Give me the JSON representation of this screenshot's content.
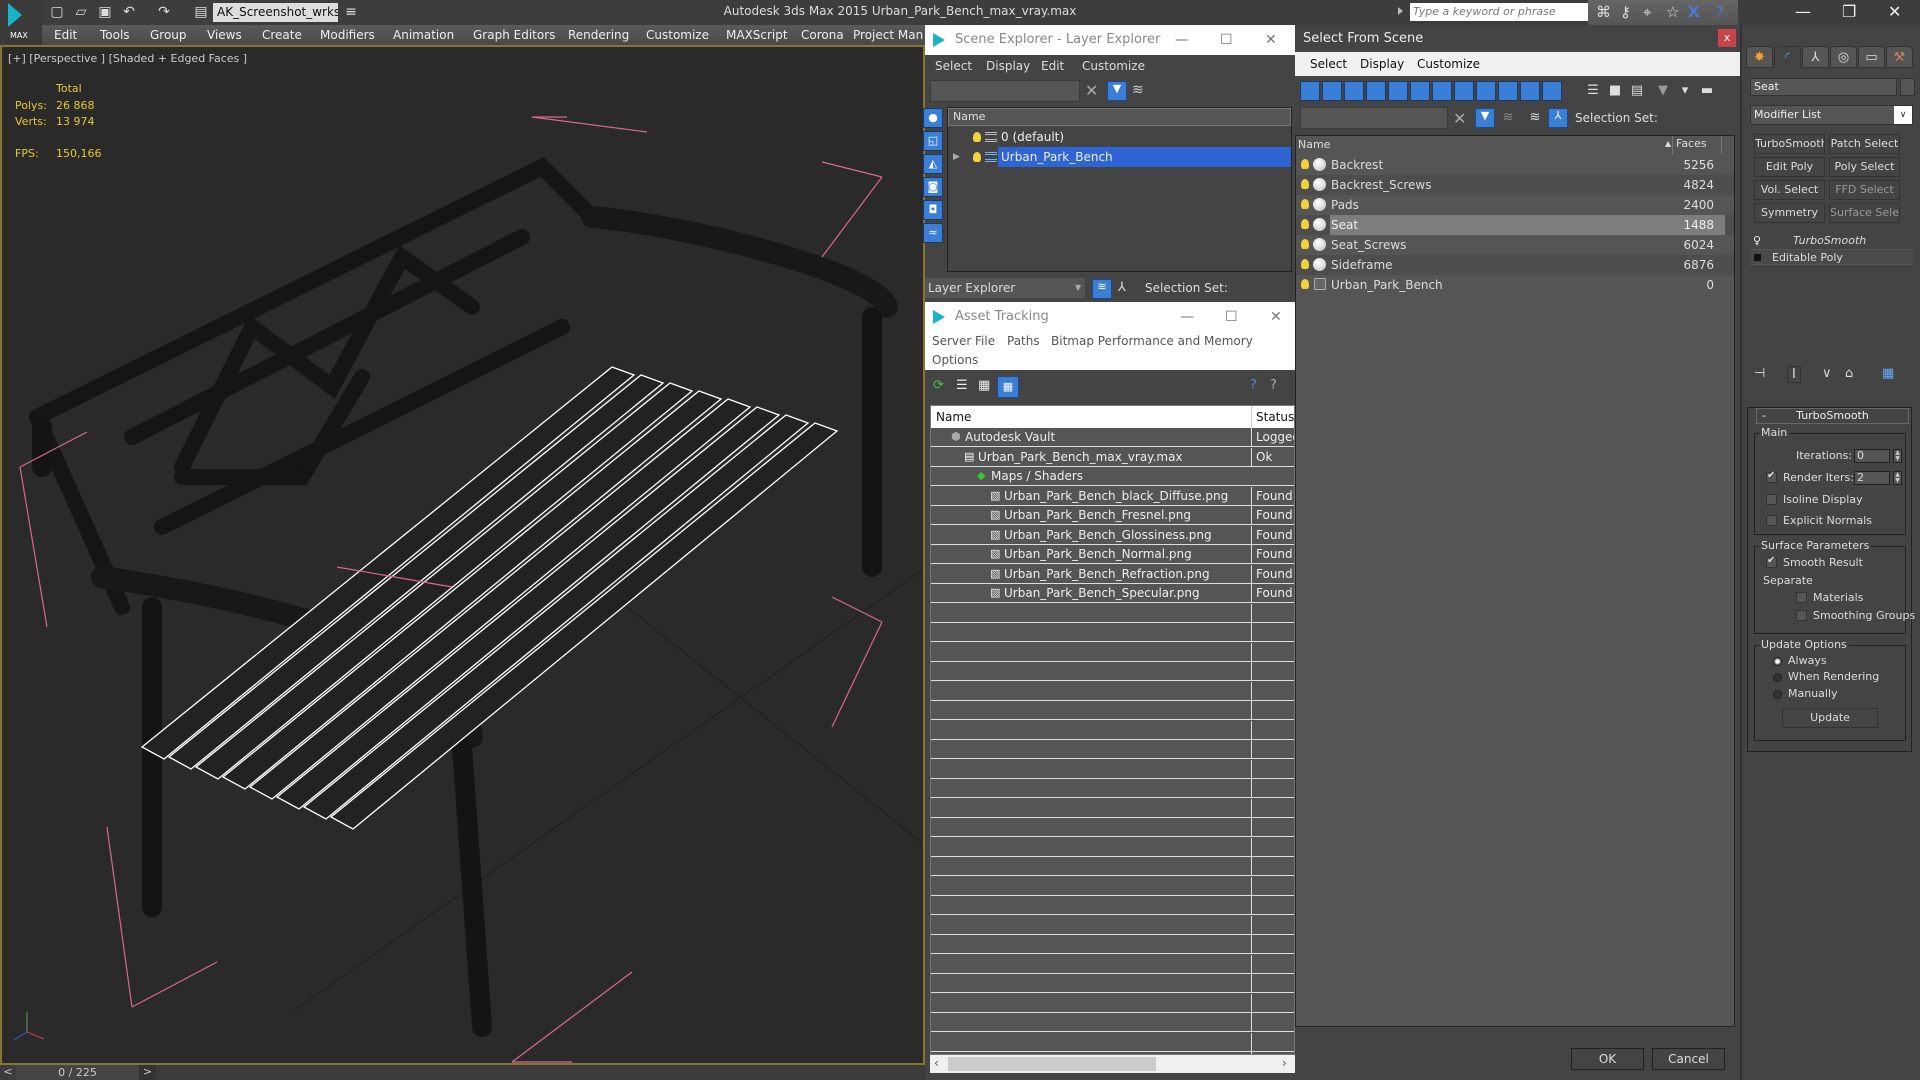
{
  "app": {
    "title": "Autodesk 3ds Max  2015    Urban_Park_Bench_max_vray.max",
    "logo_label": "MAX",
    "workspace": "AK_Screenshot_wrksp",
    "search_placeholder": "Type a keyword or phrase"
  },
  "menu": [
    "Edit",
    "Tools",
    "Group",
    "Views",
    "Create",
    "Modifiers",
    "Animation",
    "Graph Editors",
    "Rendering",
    "Customize",
    "MAXScript",
    "Corona",
    "Project Man"
  ],
  "viewport": {
    "label": "[+] [Perspective ] [Shaded + Edged Faces ]",
    "stats": {
      "total_label": "Total",
      "polys_label": "Polys:",
      "polys": "26 868",
      "verts_label": "Verts:",
      "verts": "13 974",
      "fps_label": "FPS:",
      "fps": "150,166"
    },
    "highlight_color": "#8a7434"
  },
  "timeline": {
    "prev": "<",
    "frame": "0 / 225",
    "next": ">"
  },
  "scene_explorer": {
    "title": "Scene Explorer - Layer Explorer",
    "menu": [
      "Select",
      "Display",
      "Edit",
      "Customize"
    ],
    "column": "Name",
    "rows": [
      {
        "name": "0 (default)",
        "selected": false
      },
      {
        "name": "Urban_Park_Bench",
        "selected": true
      }
    ],
    "mode": "Layer Explorer",
    "selection_set_label": "Selection Set:"
  },
  "asset_tracking": {
    "title": "Asset Tracking",
    "menu": [
      "Server",
      "File",
      "Paths",
      "Bitmap Performance and Memory",
      "Options"
    ],
    "columns": [
      "Name",
      "Status"
    ],
    "rows": [
      {
        "name": "Autodesk Vault",
        "status": "Logged",
        "level": 0,
        "icon": "vault-icon"
      },
      {
        "name": "Urban_Park_Bench_max_vray.max",
        "status": "Ok",
        "level": 1,
        "icon": "max-file-icon"
      },
      {
        "name": "Maps / Shaders",
        "status": "",
        "level": 2,
        "icon": "maps-icon"
      },
      {
        "name": "Urban_Park_Bench_black_Diffuse.png",
        "status": "Found",
        "level": 3,
        "icon": "image-file-icon"
      },
      {
        "name": "Urban_Park_Bench_Fresnel.png",
        "status": "Found",
        "level": 3,
        "icon": "image-file-icon"
      },
      {
        "name": "Urban_Park_Bench_Glossiness.png",
        "status": "Found",
        "level": 3,
        "icon": "image-file-icon"
      },
      {
        "name": "Urban_Park_Bench_Normal.png",
        "status": "Found",
        "level": 3,
        "icon": "image-file-icon"
      },
      {
        "name": "Urban_Park_Bench_Refraction.png",
        "status": "Found",
        "level": 3,
        "icon": "image-file-icon"
      },
      {
        "name": "Urban_Park_Bench_Specular.png",
        "status": "Found",
        "level": 3,
        "icon": "image-file-icon"
      }
    ]
  },
  "select_from_scene": {
    "title": "Select From Scene",
    "close": "x",
    "menu": [
      "Select",
      "Display",
      "Customize"
    ],
    "selection_set_label": "Selection Set:",
    "columns": [
      "Name",
      "Faces"
    ],
    "objects": [
      {
        "name": "Backrest",
        "faces": "5256",
        "selected": false,
        "icon": "geometry"
      },
      {
        "name": "Backrest_Screws",
        "faces": "4824",
        "selected": false,
        "icon": "geometry"
      },
      {
        "name": "Pads",
        "faces": "2400",
        "selected": false,
        "icon": "geometry"
      },
      {
        "name": "Seat",
        "faces": "1488",
        "selected": true,
        "icon": "geometry"
      },
      {
        "name": "Seat_Screws",
        "faces": "6024",
        "selected": false,
        "icon": "geometry"
      },
      {
        "name": "Sideframe",
        "faces": "6876",
        "selected": false,
        "icon": "geometry"
      },
      {
        "name": "Urban_Park_Bench",
        "faces": "0",
        "selected": false,
        "icon": "group"
      }
    ],
    "ok": "OK",
    "cancel": "Cancel"
  },
  "command_panel": {
    "object_name": "Seat",
    "modifier_list": "Modifier List",
    "modifier_buttons": [
      {
        "label": "TurboSmooth",
        "enabled": true
      },
      {
        "label": "Patch Select",
        "enabled": true
      },
      {
        "label": "Edit Poly",
        "enabled": true
      },
      {
        "label": "Poly Select",
        "enabled": true
      },
      {
        "label": "Vol. Select",
        "enabled": true
      },
      {
        "label": "FFD Select",
        "enabled": false
      },
      {
        "label": "Symmetry",
        "enabled": true
      },
      {
        "label": "Surface Select",
        "enabled": false
      }
    ],
    "stack": [
      "TurboSmooth",
      "Editable Poly"
    ],
    "turbosmooth": {
      "title": "TurboSmooth",
      "collapse": "-",
      "main_label": "Main",
      "iterations_label": "Iterations:",
      "iterations": "0",
      "render_iters_label": "Render Iters:",
      "render_iters": "2",
      "render_iters_checked": true,
      "isoline_label": "Isoline Display",
      "isoline_checked": false,
      "explicit_normals_label": "Explicit Normals",
      "explicit_normals_checked": false,
      "surface_params_label": "Surface Parameters",
      "smooth_result_label": "Smooth Result",
      "smooth_result_checked": true,
      "separate_label": "Separate",
      "materials_label": "Materials",
      "materials_checked": false,
      "smoothing_groups_label": "Smoothing Groups",
      "smoothing_groups_checked": false,
      "update_options_label": "Update Options",
      "update_options": [
        "Always",
        "When Rendering",
        "Manually"
      ],
      "update_selected": "Always",
      "update_button": "Update"
    }
  }
}
